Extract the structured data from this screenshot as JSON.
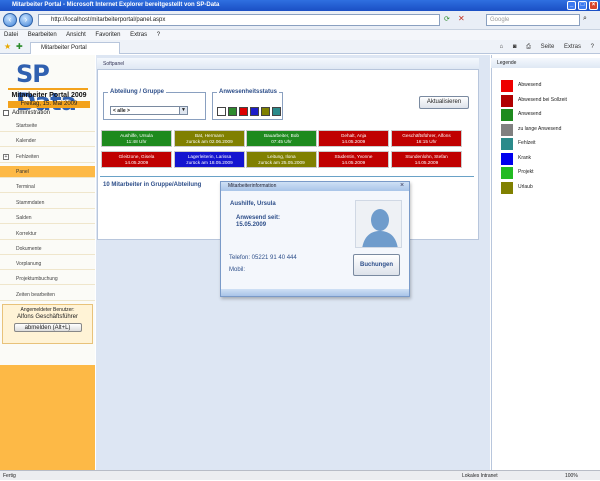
{
  "window": {
    "title": "Mitarbeiter Portal - Microsoft Internet Explorer bereitgestellt von SP-Data"
  },
  "browser": {
    "url": "http://localhost/mitarbeiterportal/panel.aspx",
    "search_placeholder": "Google",
    "menu": [
      "Datei",
      "Bearbeiten",
      "Ansicht",
      "Favoriten",
      "Extras",
      "?"
    ],
    "tab_title": "Mitarbeiter Portal",
    "tools": [
      "Seite",
      "Extras"
    ],
    "status_left": "Fertig",
    "status_zone": "Lokales Intranet",
    "zoom": "100%"
  },
  "sidebar": {
    "logo": "SP Data",
    "portal_title": "Mitarbeiter Portal 2009",
    "date": "Freitag, 15. Mai 2009",
    "admin_label": "Administration",
    "items": [
      {
        "label": "Startseite",
        "active": false,
        "expandable": false
      },
      {
        "label": "Kalender",
        "active": false,
        "expandable": false
      },
      {
        "label": "Fehlzeiten",
        "active": false,
        "expandable": true
      },
      {
        "label": "Panel",
        "active": true,
        "expandable": false
      },
      {
        "label": "Terminal",
        "active": false,
        "expandable": false
      },
      {
        "label": "Stammdaten",
        "active": false,
        "expandable": false
      },
      {
        "label": "Salden",
        "active": false,
        "expandable": false
      },
      {
        "label": "Korrektur",
        "active": false,
        "expandable": false
      },
      {
        "label": "Dokumente",
        "active": false,
        "expandable": false
      },
      {
        "label": "Vorplanung",
        "active": false,
        "expandable": false
      },
      {
        "label": "Projektumbuchung",
        "active": false,
        "expandable": false
      },
      {
        "label": "Zeiten bearbeiten",
        "active": false,
        "expandable": false
      }
    ],
    "user": {
      "caption": "Angemeldeter Benutzer:",
      "name": "Alfons Geschäftsführer",
      "logout": "abmelden (Alt+L)"
    }
  },
  "panel": {
    "title": "Softpanel",
    "group_legend": "Abteilung / Gruppe",
    "group_value": "< alle >",
    "status_legend": "Anwesenheitsstatus",
    "status_colors": [
      "#ffffff",
      "#2e8b2e",
      "#dd0000",
      "#1c1cc8",
      "#808000",
      "#2a8a8a"
    ],
    "refresh": "Aktualisieren",
    "employees": [
      {
        "name": "Aushilfe, Ursula",
        "info": "11:48 Uhr",
        "color": "#1e8a1e"
      },
      {
        "name": "Bat, Hermann",
        "info": "zurück am 02.06.2009",
        "color": "#808000"
      },
      {
        "name": "Bauarbeiter, Bob",
        "info": "07:45 Uhr",
        "color": "#1e8a1e"
      },
      {
        "name": "Gehalt, Anja",
        "info": "14.05.2009",
        "color": "#c00000"
      },
      {
        "name": "Geschäftsführer, Alfons",
        "info": "16:15 Uhr",
        "color": "#c00000"
      },
      {
        "name": "Gleitzone, Gisela",
        "info": "14.05.2009",
        "color": "#c00000"
      },
      {
        "name": "Lagerleiterin, Larissa",
        "info": "zurück am 18.05.2009",
        "color": "#1414d0"
      },
      {
        "name": "Leitung, Ilona",
        "info": "zurück am 25.05.2009",
        "color": "#808000"
      },
      {
        "name": "Studentin, Yvonne",
        "info": "14.05.2009",
        "color": "#c00000"
      },
      {
        "name": "Stundenlohn, Stefan",
        "info": "14.05.2009",
        "color": "#c00000"
      }
    ],
    "count_text": "10 Mitarbeiter in Gruppe/Abteilung"
  },
  "popup": {
    "title": "Mitarbeiterinformation",
    "name": "Aushilfe, Ursula",
    "status_line": "Anwesend seit:",
    "status_date": "15.05.2009",
    "phone": "Telefon: 05221 91 40 444",
    "mobile": "Mobil:",
    "button": "Buchungen"
  },
  "legend": {
    "title": "Legende",
    "items": [
      {
        "label": "Abwesend",
        "color": "#ee0000"
      },
      {
        "label": "Abwesend bei Sollzeit",
        "color": "#b00000"
      },
      {
        "label": "Anwesend",
        "color": "#1e8a1e"
      },
      {
        "label": "zu lange Anwesend",
        "color": "#808080"
      },
      {
        "label": "Fehlzeit",
        "color": "#2a8a8a"
      },
      {
        "label": "Krank",
        "color": "#0000ee"
      },
      {
        "label": "Projekt",
        "color": "#22bb22"
      },
      {
        "label": "Urlaub",
        "color": "#808000"
      }
    ]
  }
}
